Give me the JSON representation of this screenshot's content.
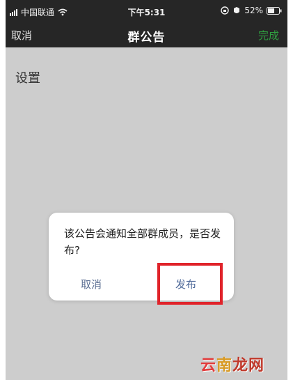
{
  "status_bar": {
    "carrier": "中国联通",
    "time": "下午5:31",
    "battery": "52%"
  },
  "nav": {
    "cancel_label": "取消",
    "title": "群公告",
    "done_label": "完成"
  },
  "editor": {
    "content": "设置"
  },
  "dialog": {
    "message": "该公告会通知全部群成员，是否发布?",
    "cancel_label": "取消",
    "publish_label": "发布"
  },
  "watermark": {
    "part1": "云",
    "part2": "南",
    "part3": "龙网"
  },
  "colors": {
    "accent_green": "#2f9e40",
    "highlight_red": "#e0232a",
    "dialog_button_blue": "#4f6a9a"
  }
}
